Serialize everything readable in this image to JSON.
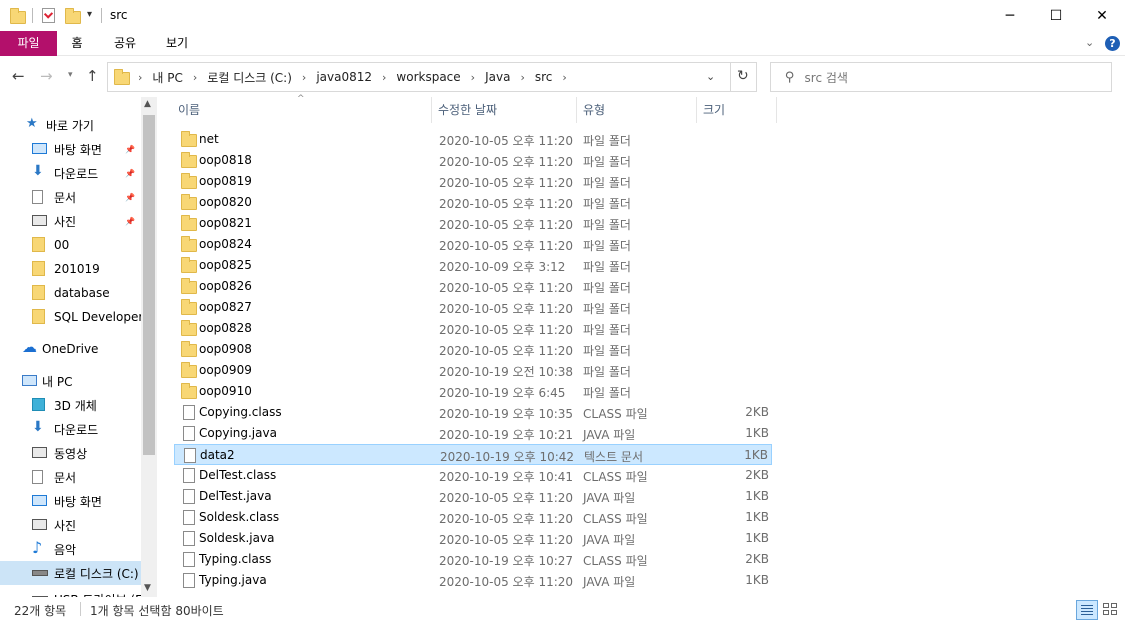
{
  "window": {
    "title": "src",
    "minimize_icon": "─",
    "maximize_icon": "☐",
    "close_icon": "✕"
  },
  "ribbon": {
    "tabs": [
      "파일",
      "홈",
      "공유",
      "보기"
    ],
    "help_icon": "?"
  },
  "address": {
    "crumbs": [
      "내 PC",
      "로컬 디스크 (C:)",
      "java0812",
      "workspace",
      "Java",
      "src"
    ],
    "search_placeholder": "src 검색"
  },
  "nav": {
    "items": [
      {
        "label": "바로 가기",
        "icon": "star-icon",
        "pinned": false
      },
      {
        "label": "바탕 화면",
        "icon": "desktop-icon",
        "pinned": true
      },
      {
        "label": "다운로드",
        "icon": "download-icon",
        "pinned": true
      },
      {
        "label": "문서",
        "icon": "document-icon",
        "pinned": true
      },
      {
        "label": "사진",
        "icon": "picture-icon",
        "pinned": true
      },
      {
        "label": "00",
        "icon": "folder-icon",
        "pinned": false
      },
      {
        "label": "201019",
        "icon": "folder-icon",
        "pinned": false
      },
      {
        "label": "database",
        "icon": "folder-icon",
        "pinned": false
      },
      {
        "label": "SQL Developer",
        "icon": "folder-icon",
        "pinned": false
      },
      {
        "label": "OneDrive",
        "icon": "cloud-icon",
        "pinned": false
      },
      {
        "label": "내 PC",
        "icon": "pc-icon",
        "pinned": false
      },
      {
        "label": "3D 개체",
        "icon": "cube-icon",
        "pinned": false
      },
      {
        "label": "다운로드",
        "icon": "download-icon",
        "pinned": false
      },
      {
        "label": "동영상",
        "icon": "video-icon",
        "pinned": false
      },
      {
        "label": "문서",
        "icon": "document-icon",
        "pinned": false
      },
      {
        "label": "바탕 화면",
        "icon": "desktop-icon",
        "pinned": false
      },
      {
        "label": "사진",
        "icon": "picture-icon",
        "pinned": false
      },
      {
        "label": "음악",
        "icon": "music-icon",
        "pinned": false
      },
      {
        "label": "로컬 디스크 (C:)",
        "icon": "drive-icon",
        "pinned": false
      },
      {
        "label": "USB 드라이브 (E",
        "icon": "usb-icon",
        "pinned": false
      }
    ]
  },
  "columns": {
    "name": "이름",
    "date": "수정한 날짜",
    "type": "유형",
    "size": "크기"
  },
  "files": [
    {
      "name": "net",
      "date": "2020-10-05 오후 11:20",
      "type": "파일 폴더",
      "size": "",
      "kind": "folder"
    },
    {
      "name": "oop0818",
      "date": "2020-10-05 오후 11:20",
      "type": "파일 폴더",
      "size": "",
      "kind": "folder"
    },
    {
      "name": "oop0819",
      "date": "2020-10-05 오후 11:20",
      "type": "파일 폴더",
      "size": "",
      "kind": "folder"
    },
    {
      "name": "oop0820",
      "date": "2020-10-05 오후 11:20",
      "type": "파일 폴더",
      "size": "",
      "kind": "folder"
    },
    {
      "name": "oop0821",
      "date": "2020-10-05 오후 11:20",
      "type": "파일 폴더",
      "size": "",
      "kind": "folder"
    },
    {
      "name": "oop0824",
      "date": "2020-10-05 오후 11:20",
      "type": "파일 폴더",
      "size": "",
      "kind": "folder"
    },
    {
      "name": "oop0825",
      "date": "2020-10-09 오후 3:12",
      "type": "파일 폴더",
      "size": "",
      "kind": "folder"
    },
    {
      "name": "oop0826",
      "date": "2020-10-05 오후 11:20",
      "type": "파일 폴더",
      "size": "",
      "kind": "folder"
    },
    {
      "name": "oop0827",
      "date": "2020-10-05 오후 11:20",
      "type": "파일 폴더",
      "size": "",
      "kind": "folder"
    },
    {
      "name": "oop0828",
      "date": "2020-10-05 오후 11:20",
      "type": "파일 폴더",
      "size": "",
      "kind": "folder"
    },
    {
      "name": "oop0908",
      "date": "2020-10-05 오후 11:20",
      "type": "파일 폴더",
      "size": "",
      "kind": "folder"
    },
    {
      "name": "oop0909",
      "date": "2020-10-19 오전 10:38",
      "type": "파일 폴더",
      "size": "",
      "kind": "folder"
    },
    {
      "name": "oop0910",
      "date": "2020-10-19 오후 6:45",
      "type": "파일 폴더",
      "size": "",
      "kind": "folder"
    },
    {
      "name": "Copying.class",
      "date": "2020-10-19 오후 10:35",
      "type": "CLASS 파일",
      "size": "2KB",
      "kind": "file"
    },
    {
      "name": "Copying.java",
      "date": "2020-10-19 오후 10:21",
      "type": "JAVA 파일",
      "size": "1KB",
      "kind": "file"
    },
    {
      "name": "data2",
      "date": "2020-10-19 오후 10:42",
      "type": "텍스트 문서",
      "size": "1KB",
      "kind": "file",
      "selected": true
    },
    {
      "name": "DelTest.class",
      "date": "2020-10-19 오후 10:41",
      "type": "CLASS 파일",
      "size": "2KB",
      "kind": "file"
    },
    {
      "name": "DelTest.java",
      "date": "2020-10-05 오후 11:20",
      "type": "JAVA 파일",
      "size": "1KB",
      "kind": "file"
    },
    {
      "name": "Soldesk.class",
      "date": "2020-10-05 오후 11:20",
      "type": "CLASS 파일",
      "size": "1KB",
      "kind": "file"
    },
    {
      "name": "Soldesk.java",
      "date": "2020-10-05 오후 11:20",
      "type": "JAVA 파일",
      "size": "1KB",
      "kind": "file"
    },
    {
      "name": "Typing.class",
      "date": "2020-10-19 오후 10:27",
      "type": "CLASS 파일",
      "size": "2KB",
      "kind": "file"
    },
    {
      "name": "Typing.java",
      "date": "2020-10-05 오후 11:20",
      "type": "JAVA 파일",
      "size": "1KB",
      "kind": "file"
    }
  ],
  "status": {
    "count": "22개 항목",
    "selection": "1개 항목 선택함 80바이트"
  },
  "colors": {
    "file_tab": "#b3106b",
    "selection": "#cce8ff",
    "folder": "#f8d775"
  }
}
